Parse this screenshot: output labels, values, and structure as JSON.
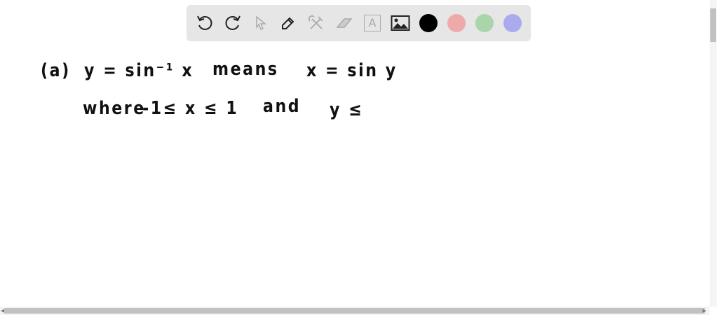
{
  "toolbar": {
    "tools": [
      "undo-icon",
      "redo-icon",
      "pointer-icon",
      "pen-icon",
      "tools-icon",
      "eraser-icon",
      "text-icon",
      "image-icon"
    ],
    "colors": {
      "black": "#000000",
      "red": "#eeaaaa",
      "green": "#aad4aa",
      "blue": "#aaaaee"
    },
    "text_tool_glyph": "A"
  },
  "canvas": {
    "line1": {
      "label": "(a)",
      "expr": "y = sin⁻¹ x",
      "word": "means",
      "expr2": "x = sin y"
    },
    "line2": {
      "word": "where",
      "cond": "-1≤ x ≤ 1",
      "word2": "and",
      "expr": "y ≤"
    }
  }
}
